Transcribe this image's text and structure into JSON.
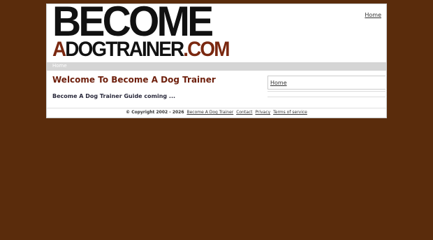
{
  "logo": {
    "line1": "BECOME",
    "line2_part1": "A",
    "line2_part2": "DOGTRAINER",
    "line2_part3": ".COM"
  },
  "header": {
    "home_link": "Home"
  },
  "navbar": {
    "item": "Home"
  },
  "main": {
    "title": "Welcome To Become A Dog Trainer",
    "text": "Become A Dog Trainer Guide coming ..."
  },
  "sidebar": {
    "home_link": "Home"
  },
  "footer": {
    "copyright": "© Copyright 2002 - 2026",
    "links": [
      "Become A Dog Trainer",
      "Contact",
      "Privacy",
      "Terms of service"
    ]
  },
  "colors": {
    "background": "#5a2c0c",
    "title": "#6e1f0c",
    "logo_accent": "#7a2810",
    "navbar": "#d5d5d5"
  }
}
